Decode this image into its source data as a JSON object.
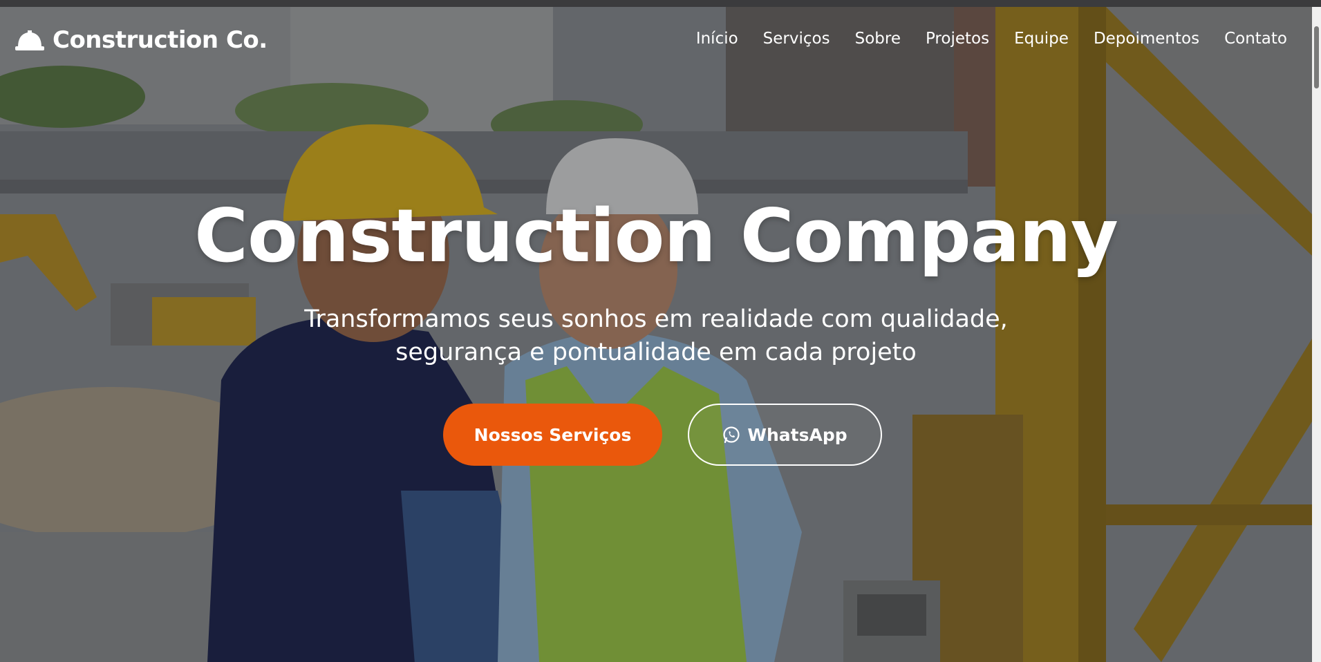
{
  "brand": {
    "name": "Construction Co.",
    "icon": "hard-hat-icon"
  },
  "nav": {
    "items": [
      {
        "label": "Início"
      },
      {
        "label": "Serviços"
      },
      {
        "label": "Sobre"
      },
      {
        "label": "Projetos"
      },
      {
        "label": "Equipe"
      },
      {
        "label": "Depoimentos"
      },
      {
        "label": "Contato"
      }
    ]
  },
  "hero": {
    "title": "Construction Company",
    "subtitle_line1": "Transformamos seus sonhos em realidade com qualidade,",
    "subtitle_line2": "segurança e pontualidade em cada projeto",
    "primary_button": "Nossos Serviços",
    "secondary_button": "WhatsApp",
    "secondary_icon": "whatsapp-icon"
  },
  "colors": {
    "accent": "#ea580c",
    "text": "#ffffff"
  }
}
